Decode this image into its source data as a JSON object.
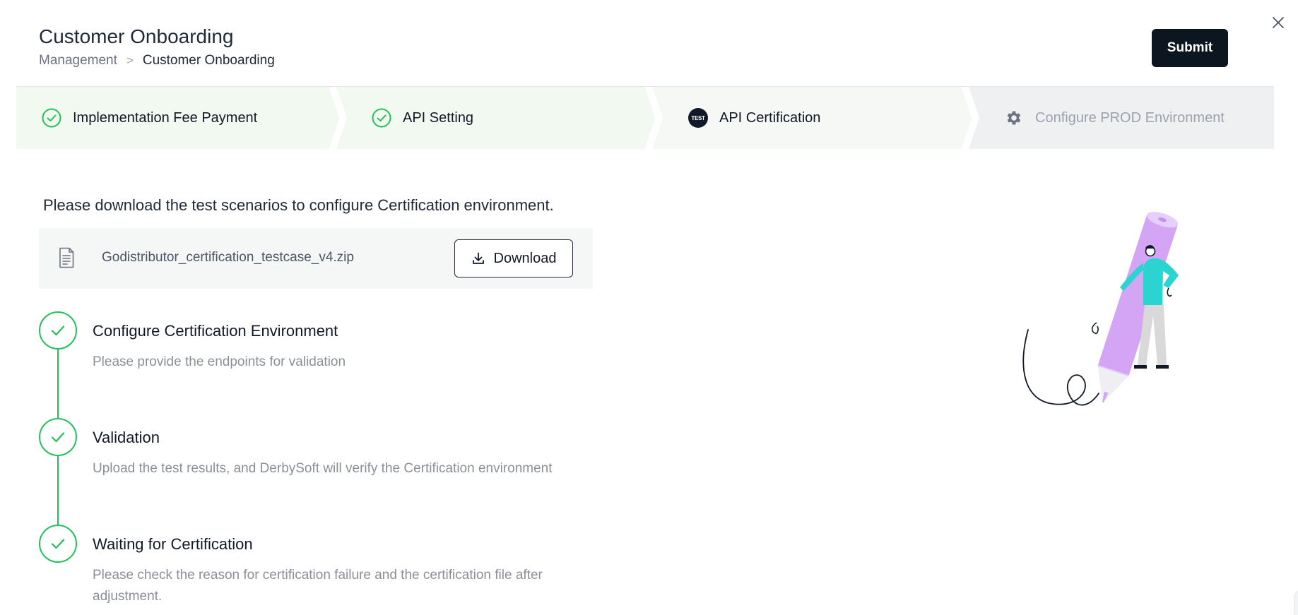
{
  "header": {
    "title": "Customer Onboarding",
    "breadcrumb": [
      "Management",
      "Customer Onboarding"
    ],
    "breadcrumb_separator": ">",
    "submit_label": "Submit",
    "close_icon": "close-icon"
  },
  "steps": [
    {
      "label": "Implementation Fee Payment",
      "status": "done",
      "icon": "check-circle-icon"
    },
    {
      "label": "API Setting",
      "status": "done",
      "icon": "check-circle-icon"
    },
    {
      "label": "API Certification",
      "status": "active",
      "icon": "test-badge-icon",
      "badge_text": "TEST"
    },
    {
      "label": "Configure PROD Environment",
      "status": "pending",
      "icon": "gear-icon"
    }
  ],
  "main": {
    "instruction": "Please download the test scenarios to configure Certification environment.",
    "file": {
      "name": "Godistributor_certification_testcase_v4.zip",
      "icon": "document-icon",
      "download_label": "Download"
    },
    "timeline": [
      {
        "title": "Configure Certification Environment",
        "description": "Please provide the endpoints for validation",
        "status": "done"
      },
      {
        "title": "Validation",
        "description": "Upload the test results, and DerbySoft will verify the Certification environment",
        "status": "done"
      },
      {
        "title": "Waiting for Certification",
        "description": "Please check the reason for certification failure and the certification file after adjustment.",
        "status": "done"
      }
    ]
  },
  "colors": {
    "success": "#22c05a",
    "done_step_bg": "#f1f9f1",
    "active_step_bg": "#f6f8f6",
    "pending_step_bg": "#eef0f1",
    "primary_button": "#0b1620",
    "pencil": "#d4a5f5",
    "person_shirt": "#2ad4d0"
  }
}
